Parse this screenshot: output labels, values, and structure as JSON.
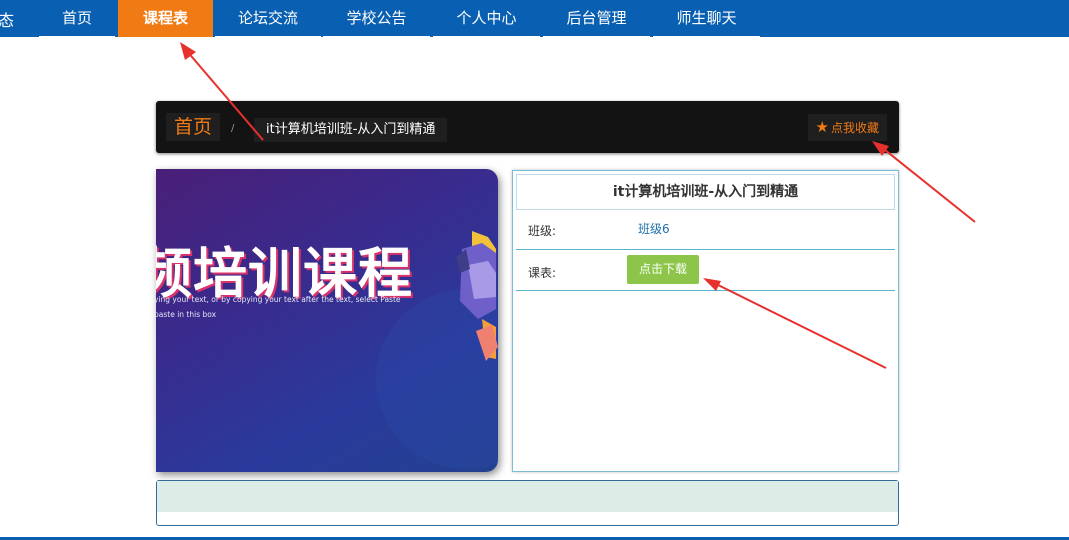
{
  "nav": {
    "brand_fragment": "态",
    "items": [
      {
        "label": "首页"
      },
      {
        "label": "课程表"
      },
      {
        "label": "论坛交流"
      },
      {
        "label": "学校公告"
      },
      {
        "label": "个人中心"
      },
      {
        "label": "后台管理"
      },
      {
        "label": "师生聊天"
      }
    ],
    "active_index": 1
  },
  "breadcrumb": {
    "home": "首页",
    "separator": "/",
    "current": "it计算机培训班-从入门到精通",
    "favorite_icon": "star-icon",
    "favorite_label": "点我收藏"
  },
  "banner": {
    "title": "频培训课程",
    "subtitle": "ying your text, or by copying your text after the text, select Paste paste in this box"
  },
  "course": {
    "title": "it计算机培训班-从入门到精通",
    "class_label": "班级:",
    "class_value": "班级6",
    "schedule_label": "课表:",
    "download_label": "点击下载"
  },
  "colors": {
    "nav_bg": "#0960b2",
    "accent_orange": "#f07a14",
    "download_green": "#8cc54a",
    "crumb_bg": "#131313",
    "annotation_red": "#e8302c"
  }
}
